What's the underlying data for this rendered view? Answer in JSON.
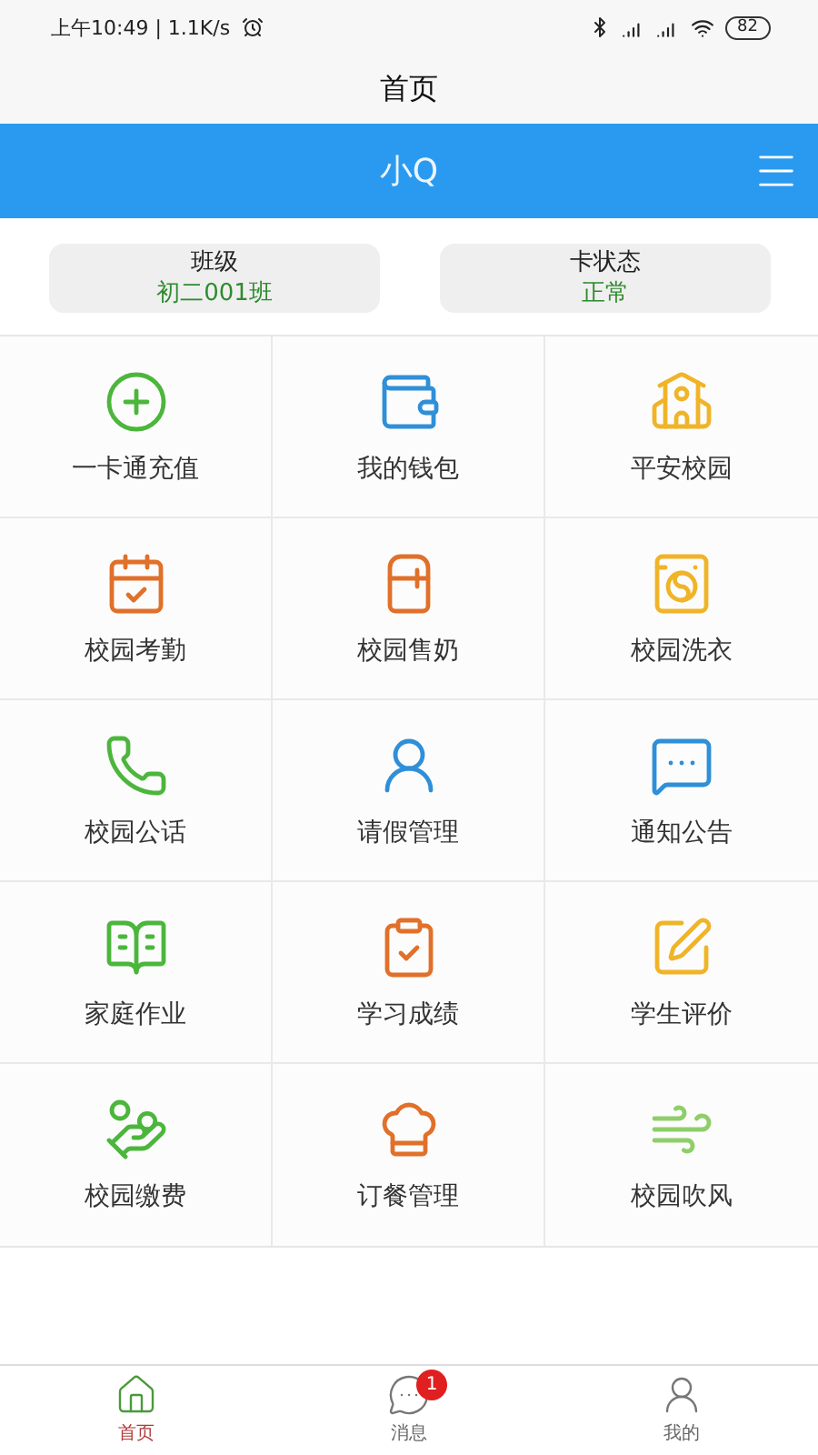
{
  "status_bar": {
    "time": "上午10:49 | 1.1K/s",
    "battery": "82"
  },
  "title": "首页",
  "header": {
    "title": "小Q"
  },
  "info_cards": [
    {
      "label": "班级",
      "value": "初二001班"
    },
    {
      "label": "卡状态",
      "value": "正常"
    }
  ],
  "tiles": [
    {
      "label": "一卡通充值",
      "color": "#4cb63c"
    },
    {
      "label": "我的钱包",
      "color": "#2f8fd8"
    },
    {
      "label": "平安校园",
      "color": "#f0b429"
    },
    {
      "label": "校园考勤",
      "color": "#e0702a"
    },
    {
      "label": "校园售奶",
      "color": "#e0702a"
    },
    {
      "label": "校园洗衣",
      "color": "#f0b429"
    },
    {
      "label": "校园公话",
      "color": "#4cb63c"
    },
    {
      "label": "请假管理",
      "color": "#2f8fd8"
    },
    {
      "label": "通知公告",
      "color": "#2f8fd8"
    },
    {
      "label": "家庭作业",
      "color": "#4cb63c"
    },
    {
      "label": "学习成绩",
      "color": "#e0702a"
    },
    {
      "label": "学生评价",
      "color": "#f0b429"
    },
    {
      "label": "校园缴费",
      "color": "#4cb63c"
    },
    {
      "label": "订餐管理",
      "color": "#e0702a"
    },
    {
      "label": "校园吹风",
      "color": "#8fce6a"
    }
  ],
  "bottom_nav": [
    {
      "label": "首页",
      "selected": true
    },
    {
      "label": "消息",
      "selected": false,
      "badge": "1"
    },
    {
      "label": "我的",
      "selected": false
    }
  ]
}
